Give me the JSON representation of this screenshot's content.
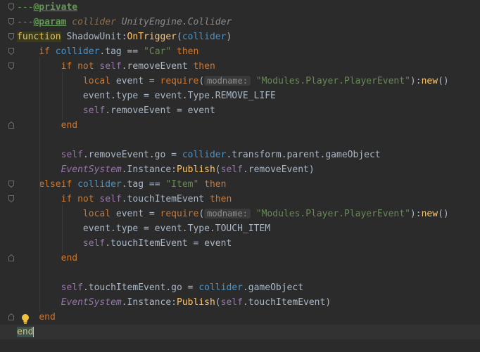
{
  "editor": {
    "lines": [
      {
        "tokens": [
          {
            "t": "---",
            "c": "cmt"
          },
          {
            "t": "@private",
            "c": "cmt-tag"
          }
        ]
      },
      {
        "tokens": [
          {
            "t": "---",
            "c": "cmt"
          },
          {
            "t": "@param",
            "c": "cmt-tag"
          },
          {
            "t": " collider ",
            "c": "cmt-name"
          },
          {
            "t": "UnityEngine.Collider",
            "c": "cmt-type"
          }
        ]
      },
      {
        "tokens": [
          {
            "t": "function",
            "c": "fn-kw"
          },
          {
            "t": " ShadowUnit:",
            "c": "id"
          },
          {
            "t": "OnTrigger",
            "c": "fn"
          },
          {
            "t": "(",
            "c": "id"
          },
          {
            "t": "collider",
            "c": "param"
          },
          {
            "t": ")",
            "c": "id"
          }
        ]
      },
      {
        "tokens": [
          {
            "t": "    ",
            "c": "id"
          },
          {
            "t": "if",
            "c": "kw"
          },
          {
            "t": " ",
            "c": "id"
          },
          {
            "t": "collider",
            "c": "param"
          },
          {
            "t": ".tag == ",
            "c": "id"
          },
          {
            "t": "\"Car\"",
            "c": "str"
          },
          {
            "t": " ",
            "c": "id"
          },
          {
            "t": "then",
            "c": "kw"
          }
        ]
      },
      {
        "tokens": [
          {
            "t": "        ",
            "c": "id"
          },
          {
            "t": "if not",
            "c": "kw"
          },
          {
            "t": " ",
            "c": "id"
          },
          {
            "t": "self",
            "c": "self"
          },
          {
            "t": ".removeEvent ",
            "c": "id"
          },
          {
            "t": "then",
            "c": "kw"
          }
        ]
      },
      {
        "tokens": [
          {
            "t": "            ",
            "c": "id"
          },
          {
            "t": "local",
            "c": "kw"
          },
          {
            "t": " event = ",
            "c": "id"
          },
          {
            "t": "require",
            "c": "kw"
          },
          {
            "t": "(",
            "c": "id"
          },
          {
            "t": "modname:",
            "c": "hint"
          },
          {
            "t": " ",
            "c": "id"
          },
          {
            "t": "\"Modules.Player.PlayerEvent\"",
            "c": "str"
          },
          {
            "t": "):",
            "c": "id"
          },
          {
            "t": "new",
            "c": "fn"
          },
          {
            "t": "()",
            "c": "id"
          }
        ]
      },
      {
        "tokens": [
          {
            "t": "            event.type = event.Type.REMOVE_LIFE",
            "c": "id"
          }
        ]
      },
      {
        "tokens": [
          {
            "t": "            ",
            "c": "id"
          },
          {
            "t": "self",
            "c": "self"
          },
          {
            "t": ".removeEvent = event",
            "c": "id"
          }
        ]
      },
      {
        "tokens": [
          {
            "t": "        ",
            "c": "id"
          },
          {
            "t": "end",
            "c": "kw"
          }
        ]
      },
      {
        "tokens": []
      },
      {
        "tokens": [
          {
            "t": "        ",
            "c": "id"
          },
          {
            "t": "self",
            "c": "self"
          },
          {
            "t": ".removeEvent.go = ",
            "c": "id"
          },
          {
            "t": "collider",
            "c": "param"
          },
          {
            "t": ".transform.parent.gameObject",
            "c": "id"
          }
        ]
      },
      {
        "tokens": [
          {
            "t": "        ",
            "c": "id"
          },
          {
            "t": "EventSystem",
            "c": "class-it"
          },
          {
            "t": ".Instance:",
            "c": "id"
          },
          {
            "t": "Publish",
            "c": "fn"
          },
          {
            "t": "(",
            "c": "id"
          },
          {
            "t": "self",
            "c": "self"
          },
          {
            "t": ".removeEvent)",
            "c": "id"
          }
        ]
      },
      {
        "tokens": [
          {
            "t": "    ",
            "c": "id"
          },
          {
            "t": "elseif",
            "c": "kw"
          },
          {
            "t": " ",
            "c": "id"
          },
          {
            "t": "collider",
            "c": "param"
          },
          {
            "t": ".tag == ",
            "c": "id"
          },
          {
            "t": "\"Item\"",
            "c": "str"
          },
          {
            "t": " ",
            "c": "id"
          },
          {
            "t": "then",
            "c": "kw"
          }
        ]
      },
      {
        "tokens": [
          {
            "t": "        ",
            "c": "id"
          },
          {
            "t": "if not",
            "c": "kw"
          },
          {
            "t": " ",
            "c": "id"
          },
          {
            "t": "self",
            "c": "self"
          },
          {
            "t": ".touchItemEvent ",
            "c": "id"
          },
          {
            "t": "then",
            "c": "kw"
          }
        ]
      },
      {
        "tokens": [
          {
            "t": "            ",
            "c": "id"
          },
          {
            "t": "local",
            "c": "kw"
          },
          {
            "t": " event = ",
            "c": "id"
          },
          {
            "t": "require",
            "c": "kw"
          },
          {
            "t": "(",
            "c": "id"
          },
          {
            "t": "modname:",
            "c": "hint"
          },
          {
            "t": " ",
            "c": "id"
          },
          {
            "t": "\"Modules.Player.PlayerEvent\"",
            "c": "str"
          },
          {
            "t": "):",
            "c": "id"
          },
          {
            "t": "new",
            "c": "fn"
          },
          {
            "t": "()",
            "c": "id"
          }
        ]
      },
      {
        "tokens": [
          {
            "t": "            event.type = event.Type.TOUCH_ITEM",
            "c": "id"
          }
        ]
      },
      {
        "tokens": [
          {
            "t": "            ",
            "c": "id"
          },
          {
            "t": "self",
            "c": "self"
          },
          {
            "t": ".touchItemEvent = event",
            "c": "id"
          }
        ]
      },
      {
        "tokens": [
          {
            "t": "        ",
            "c": "id"
          },
          {
            "t": "end",
            "c": "kw"
          }
        ]
      },
      {
        "tokens": []
      },
      {
        "tokens": [
          {
            "t": "        ",
            "c": "id"
          },
          {
            "t": "self",
            "c": "self"
          },
          {
            "t": ".touchItemEvent.go = ",
            "c": "id"
          },
          {
            "t": "collider",
            "c": "param"
          },
          {
            "t": ".gameObject",
            "c": "id"
          }
        ]
      },
      {
        "tokens": [
          {
            "t": "        ",
            "c": "id"
          },
          {
            "t": "EventSystem",
            "c": "class-it"
          },
          {
            "t": ".Instance:",
            "c": "id"
          },
          {
            "t": "Publish",
            "c": "fn"
          },
          {
            "t": "(",
            "c": "id"
          },
          {
            "t": "self",
            "c": "self"
          },
          {
            "t": ".touchItemEvent)",
            "c": "id"
          }
        ]
      },
      {
        "tokens": [
          {
            "t": "    ",
            "c": "id"
          },
          {
            "t": "end",
            "c": "kw"
          }
        ]
      },
      {
        "tokens": [
          {
            "t": "end",
            "c": "end-hl"
          }
        ]
      }
    ],
    "fold_marker_lines": [
      0,
      1,
      2,
      3,
      4,
      8,
      12,
      13,
      17,
      21,
      22
    ],
    "intention_icon": "lightbulb-icon"
  }
}
